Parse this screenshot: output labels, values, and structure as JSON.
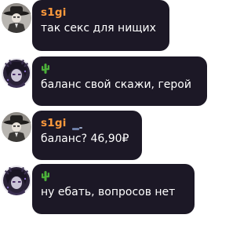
{
  "messages": [
    {
      "author": "s1gi",
      "author_color": "#ff9a3c",
      "avatar": "cowboy-hat-avatar",
      "text": "так секс для нищих"
    },
    {
      "author": "",
      "author_icon": "cactus-icon",
      "avatar": "dark-anime-avatar",
      "text": "баланс свой скажи, герой"
    },
    {
      "author": "s1gi",
      "author_color": "#ff9a3c",
      "author_badge": "blue-badge-icon",
      "avatar": "cowboy-hat-avatar",
      "text": "баланс? 46,90₽"
    },
    {
      "author": "",
      "author_icon": "cactus-icon",
      "avatar": "dark-anime-avatar",
      "text": "ну ебать, вопросов нет"
    }
  ],
  "colors": {
    "bubble_bg": "#1c1826",
    "name": "#ff9a3c",
    "cactus": "#4caf3a",
    "text": "#ffffff"
  }
}
